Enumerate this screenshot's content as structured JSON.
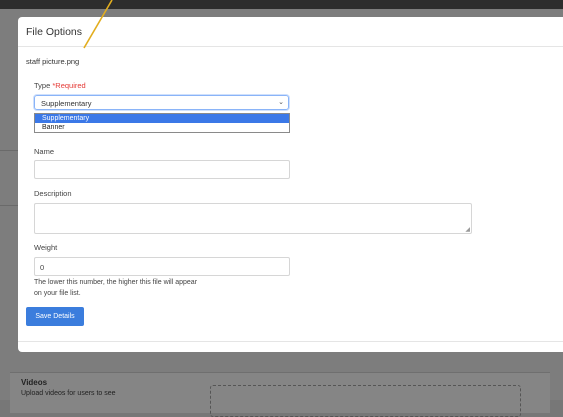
{
  "background": {
    "videos_title": "Videos",
    "videos_subtitle": "Upload videos for users to see"
  },
  "modal": {
    "title": "File Options",
    "filename": "staff picture.png",
    "type": {
      "label": "Type",
      "required": "*Required",
      "selected": "Supplementary",
      "options": [
        "Supplementary",
        "Banner"
      ]
    },
    "name": {
      "label": "Name",
      "value": ""
    },
    "description": {
      "label": "Description",
      "value": ""
    },
    "weight": {
      "label": "Weight",
      "value": "0",
      "hint": "The lower this number, the higher this file will appear on your file list."
    },
    "save_label": "Save Details"
  },
  "colors": {
    "primary": "#3b7ddd",
    "required": "#e53935",
    "annotation": "#e2ad1e"
  }
}
